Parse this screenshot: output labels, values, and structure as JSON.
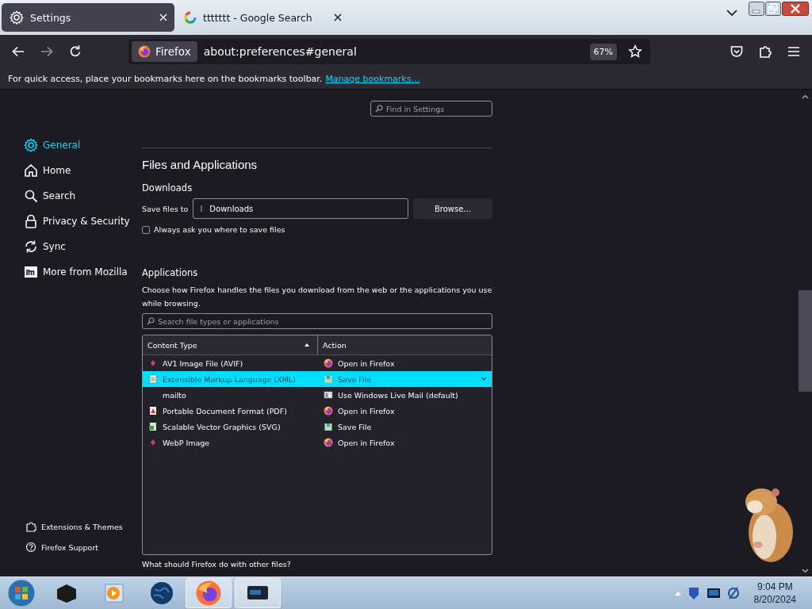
{
  "tabs": [
    {
      "title": "Settings",
      "selected": true
    },
    {
      "title": "ttttttt - Google Search",
      "selected": false
    }
  ],
  "toolbar": {
    "identity": "Firefox",
    "url": "about:preferences#general",
    "zoom": "67%"
  },
  "bookmarks_bar": {
    "message": "For quick access, place your bookmarks here on the bookmarks toolbar.",
    "link": "Manage bookmarks…"
  },
  "find": {
    "placeholder": "Find in Settings"
  },
  "sidebar": {
    "items": [
      {
        "label": "General",
        "selected": true
      },
      {
        "label": "Home",
        "selected": false
      },
      {
        "label": "Search",
        "selected": false
      },
      {
        "label": "Privacy & Security",
        "selected": false
      },
      {
        "label": "Sync",
        "selected": false
      },
      {
        "label": "More from Mozilla",
        "selected": false
      }
    ],
    "footer": [
      {
        "label": "Extensions & Themes"
      },
      {
        "label": "Firefox Support"
      }
    ]
  },
  "section": {
    "title": "Files and Applications",
    "downloads": {
      "heading": "Downloads",
      "save_label": "Save files to",
      "folder": "Downloads",
      "browse": "Browse…",
      "always_ask": {
        "label": "Always ask you where to save files",
        "checked": false
      }
    },
    "applications": {
      "heading": "Applications",
      "description": "Choose how Firefox handles the files you download from the web or the applications you use while browsing.",
      "search": {
        "placeholder": "Search file types or applications"
      },
      "columns": [
        "Content Type",
        "Action"
      ],
      "rows": [
        {
          "type": "AV1 Image File (AVIF)",
          "action": "Open in Firefox",
          "selected": false
        },
        {
          "type": "Extensible Markup Language (XML)",
          "action": "Save File",
          "selected": true
        },
        {
          "type": "mailto",
          "action": "Use Windows Live Mail (default)",
          "selected": false
        },
        {
          "type": "Portable Document Format (PDF)",
          "action": "Open in Firefox",
          "selected": false
        },
        {
          "type": "Scalable Vector Graphics (SVG)",
          "action": "Save File",
          "selected": false
        },
        {
          "type": "WebP Image",
          "action": "Open in Firefox",
          "selected": false
        }
      ]
    },
    "other_files_question": "What should Firefox do with other files?"
  },
  "taskbar": {
    "time": "9:04 PM",
    "date": "8/20/2024"
  }
}
